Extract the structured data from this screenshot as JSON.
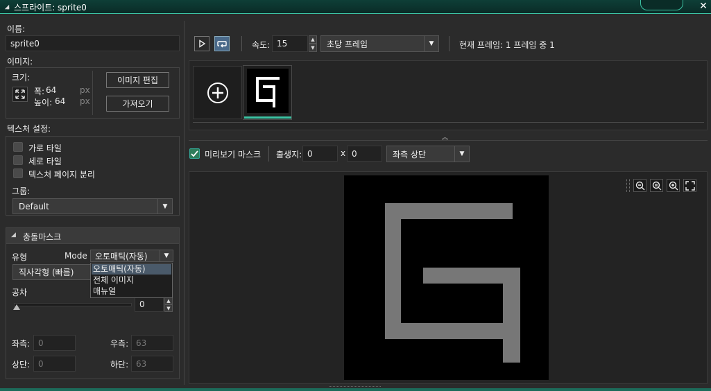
{
  "window": {
    "title": "스프라이트: sprite0",
    "close_glyph": "✕"
  },
  "left": {
    "name_label": "이름:",
    "name_value": "sprite0",
    "image_label": "이미지:",
    "size_label": "크기:",
    "width_label": "폭:",
    "width_value": "64",
    "width_unit": "px",
    "height_label": "높이:",
    "height_value": "64",
    "height_unit": "px",
    "edit_image_button": "이미지 편집",
    "import_button": "가져오기",
    "texture_settings_label": "텍스처 설정:",
    "checkboxes": [
      {
        "label": "가로 타일",
        "checked": false
      },
      {
        "label": "세로 타일",
        "checked": false
      },
      {
        "label": "텍스처 페이지 분리",
        "checked": false
      }
    ],
    "group_label": "그룹:",
    "group_value": "Default",
    "collision": {
      "header": "충돌마스크",
      "type_label": "유형",
      "mode_label": "Mode",
      "mode_value": "오토매틱(자동)",
      "mode_options": [
        "오토매틱(자동)",
        "전체 이미지",
        "매뉴얼"
      ],
      "shape_value": "직사각형 (빠름)",
      "tolerance_label": "공차",
      "tolerance_value": "0",
      "tolerance_level": 0,
      "left_label": "좌측:",
      "left_value": "0",
      "right_label": "우측:",
      "right_value": "63",
      "top_label": "상단:",
      "top_value": "0",
      "bottom_label": "하단:",
      "bottom_value": "63"
    }
  },
  "toolbar": {
    "speed_label": "속도:",
    "speed_value": "15",
    "speed_unit": "초당 프레임",
    "current_frame": "현재 프레임: 1 프레임 중 1"
  },
  "origin_bar": {
    "preview_mask_label": "미리보기 마스크",
    "preview_mask_checked": true,
    "origin_label": "출생지:",
    "origin_x": "0",
    "x_sep": "x",
    "origin_y": "0",
    "origin_preset": "좌측 상단"
  },
  "colors": {
    "accent": "#3cc4a4",
    "sprite_fill": "#777777",
    "canvas_bg": "#000000",
    "titlebar": "#0e3f37"
  }
}
